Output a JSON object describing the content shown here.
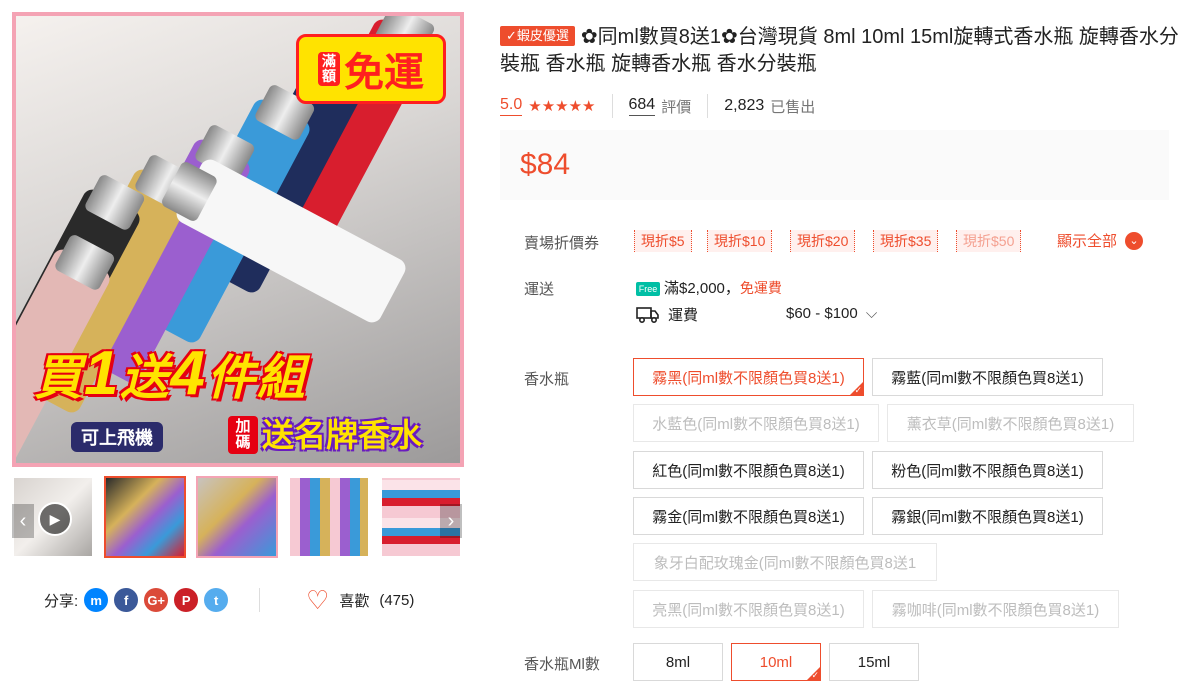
{
  "title": {
    "badge": "✓蝦皮優選",
    "text": "✿同ml數買8送1✿台灣現貨 8ml 10ml 15ml旋轉式香水瓶 旋轉香水分裝瓶 香水瓶 旋轉香水瓶 香水分裝瓶"
  },
  "stats": {
    "rating": "5.0",
    "stars": "★★★★★",
    "reviews_count": "684",
    "reviews_label": "評價",
    "sold_count": "2,823",
    "sold_label": "已售出"
  },
  "price": "$84",
  "vouchers": {
    "label": "賣場折價券",
    "items": [
      "現折$5",
      "現折$10",
      "現折$20",
      "現折$35",
      "現折$50"
    ],
    "show_all": "顯示全部"
  },
  "shipping": {
    "label": "運送",
    "free_icon_text": "Free",
    "threshold": "滿$2,000，",
    "free_text": "免運費",
    "fee_label": "運費",
    "fee_range": "$60 - $100"
  },
  "variant_bottle": {
    "label": "香水瓶",
    "options": [
      "霧黑(同ml數不限顏色買8送1)",
      "霧藍(同ml數不限顏色買8送1)",
      "水藍色(同ml數不限顏色買8送1)",
      "薰衣草(同ml數不限顏色買8送1)",
      "紅色(同ml數不限顏色買8送1)",
      "粉色(同ml數不限顏色買8送1)",
      "霧金(同ml數不限顏色買8送1)",
      "霧銀(同ml數不限顏色買8送1)",
      "象牙白配玫瑰金(同ml數不限顏色買8送1",
      "亮黑(同ml數不限顏色買8送1)",
      "霧咖啡(同ml數不限顏色買8送1)"
    ]
  },
  "variant_size": {
    "label": "香水瓶Ml數",
    "options": [
      "8ml",
      "10ml",
      "15ml"
    ]
  },
  "image_promo": {
    "free_small": "滿額",
    "free_big": "免運",
    "main_pre": "買",
    "main_num1": "1",
    "main_mid": "送",
    "main_num2": "4",
    "main_post": "件組",
    "plane": "可上飛機",
    "plus": "加碼",
    "gift": "送名牌香水"
  },
  "share": {
    "label": "分享:",
    "icons": [
      "messenger-icon",
      "facebook-icon",
      "google-plus-icon",
      "pinterest-icon",
      "twitter-icon"
    ]
  },
  "like": {
    "label": "喜歡",
    "count": "(475)"
  },
  "colors": {
    "accent": "#ee4d2d",
    "badge_border": "#f4a3b4"
  }
}
